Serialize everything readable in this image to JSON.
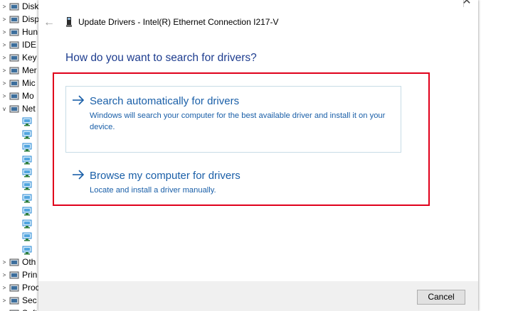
{
  "device_manager": {
    "categories": [
      {
        "label": "Disk",
        "expander": ">",
        "icon": "disk-drive-icon"
      },
      {
        "label": "Disp",
        "expander": ">",
        "icon": "display-adapter-icon"
      },
      {
        "label": "Hun",
        "expander": ">",
        "icon": "human-interface-icon"
      },
      {
        "label": "IDE",
        "expander": ">",
        "icon": "ide-controller-icon"
      },
      {
        "label": "Key",
        "expander": ">",
        "icon": "keyboard-icon"
      },
      {
        "label": "Mer",
        "expander": ">",
        "icon": "memory-device-icon"
      },
      {
        "label": "Mic",
        "expander": ">",
        "icon": "mouse-icon"
      },
      {
        "label": "Mo",
        "expander": ">",
        "icon": "monitor-icon"
      },
      {
        "label": "Net",
        "expander": "v",
        "icon": "network-adapter-icon"
      }
    ],
    "bottom_categories": [
      {
        "label": "Oth",
        "expander": ">",
        "icon": "other-device-icon"
      },
      {
        "label": "Prin",
        "expander": ">",
        "icon": "print-queue-icon"
      },
      {
        "label": "Proc",
        "expander": ">",
        "icon": "processor-icon"
      },
      {
        "label": "Sec",
        "expander": ">",
        "icon": "security-device-icon"
      },
      {
        "label": "Soft",
        "expander": ">",
        "icon": "software-device-icon"
      }
    ]
  },
  "dialog": {
    "title": "Update Drivers - Intel(R) Ethernet Connection I217-V",
    "heading": "How do you want to search for drivers?",
    "options": [
      {
        "title": "Search automatically for drivers",
        "description": "Windows will search your computer for the best available driver and install it on your device."
      },
      {
        "title": "Browse my computer for drivers",
        "description": "Locate and install a driver manually."
      }
    ],
    "cancel_label": "Cancel",
    "close_glyph": "✕",
    "back_glyph": "←"
  },
  "colors": {
    "heading": "#1e3d8f",
    "option_text": "#1a5fa8",
    "highlight": "#e0001b"
  }
}
